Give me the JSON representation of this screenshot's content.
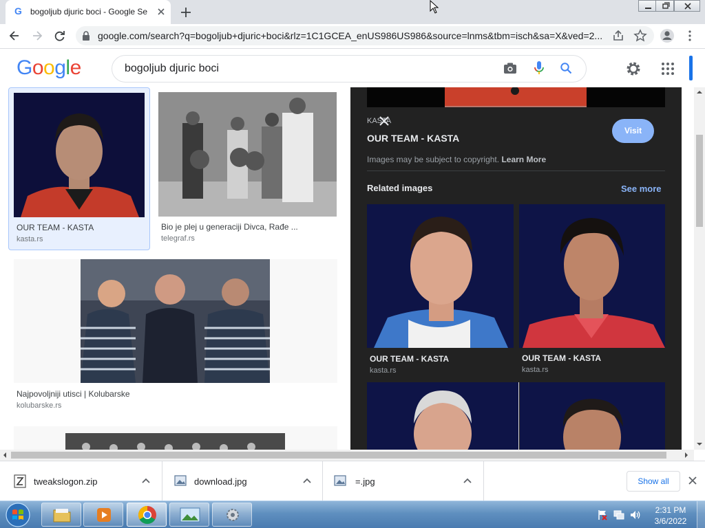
{
  "browser": {
    "tab_title": "bogoljub djuric boci - Google Se",
    "url": "google.com/search?q=bogoljub+djuric+boci&rlz=1C1GCEA_enUS986US986&source=lnms&tbm=isch&sa=X&ved=2..."
  },
  "google": {
    "logo_letters": [
      "G",
      "o",
      "o",
      "g",
      "l",
      "e"
    ],
    "logo_colors": [
      "#4285f4",
      "#ea4335",
      "#fbbc05",
      "#4285f4",
      "#34a853",
      "#ea4335"
    ],
    "query": "bogoljub djuric boci"
  },
  "results": [
    {
      "caption": "OUR TEAM - KASTA",
      "source": "kasta.rs"
    },
    {
      "caption": "Bio je plej u generaciji Divca, Rađe ...",
      "source": "telegraf.rs"
    },
    {
      "caption": "Najpovoljniji utisci | Kolubarske",
      "source": "kolubarske.rs"
    }
  ],
  "panel": {
    "site": "KASTA",
    "title": "OUR TEAM - KASTA",
    "visit_label": "Visit",
    "copyright": "Images may be subject to copyright.",
    "learn_more": "Learn More",
    "related_heading": "Related images",
    "see_more": "See more",
    "related": [
      {
        "caption": "OUR TEAM - KASTA",
        "source": "kasta.rs"
      },
      {
        "caption": "OUR TEAM - KASTA",
        "source": "kasta.rs"
      }
    ]
  },
  "downloads": [
    {
      "name": "tweakslogon.zip"
    },
    {
      "name": "download.jpg"
    },
    {
      "name": "=.jpg"
    }
  ],
  "show_all_label": "Show all",
  "clock": {
    "time": "2:31 PM",
    "date": "3/6/2022"
  }
}
